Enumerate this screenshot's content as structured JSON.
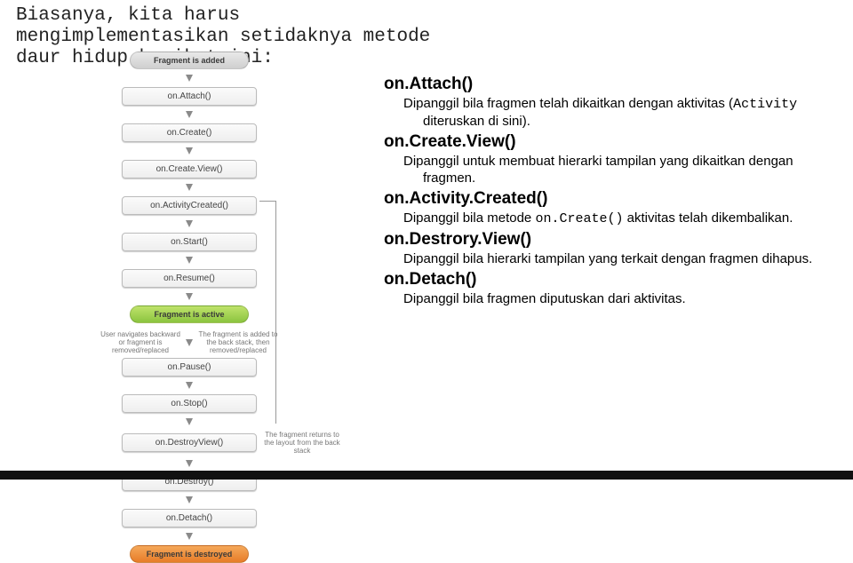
{
  "intro": "Biasanya, kita harus mengimplementasikan setidaknya metode daur hidup berikut ini:",
  "flow": {
    "added": "Fragment is added",
    "active": "Fragment is active",
    "destroyed": "Fragment is destroyed",
    "pills": {
      "onAttach": "on.Attach()",
      "onCreate": "on.Create()",
      "onCreateView": "on.Create.View()",
      "onActivityCreated": "on.ActivityCreated()",
      "onStart": "on.Start()",
      "onResume": "on.Resume()",
      "onPause": "on.Pause()",
      "onStop": "on.Stop()",
      "onDestroyView": "on.DestroyView()",
      "onDestroy": "on.Destroy()",
      "onDetach": "on.Detach()"
    },
    "notes": {
      "navback": "User navigates backward or fragment is removed/replaced",
      "toback": "The fragment is added to the back stack, then removed/replaced",
      "fromback": "The fragment returns to the layout from the back stack"
    }
  },
  "methods": [
    {
      "name": "on.Attach()",
      "desc_pre": "Dipanggil bila fragmen telah dikaitkan dengan aktivitas (",
      "code": "Activity",
      "desc_post": " diteruskan di sini)."
    },
    {
      "name": "on.Create.View()",
      "desc_pre": "Dipanggil untuk membuat hierarki tampilan yang dikaitkan dengan fragmen.",
      "code": "",
      "desc_post": ""
    },
    {
      "name": "on.Activity.Created()",
      "desc_pre": "Dipanggil bila metode ",
      "code": "on.Create()",
      "desc_post": " aktivitas telah dikembalikan."
    },
    {
      "name": "on.Destrory.View()",
      "desc_pre": "Dipanggil bila hierarki tampilan yang terkait dengan fragmen dihapus.",
      "code": "",
      "desc_post": ""
    },
    {
      "name": "on.Detach()",
      "desc_pre": "Dipanggil bila fragmen diputuskan dari aktivitas.",
      "code": "",
      "desc_post": ""
    }
  ]
}
